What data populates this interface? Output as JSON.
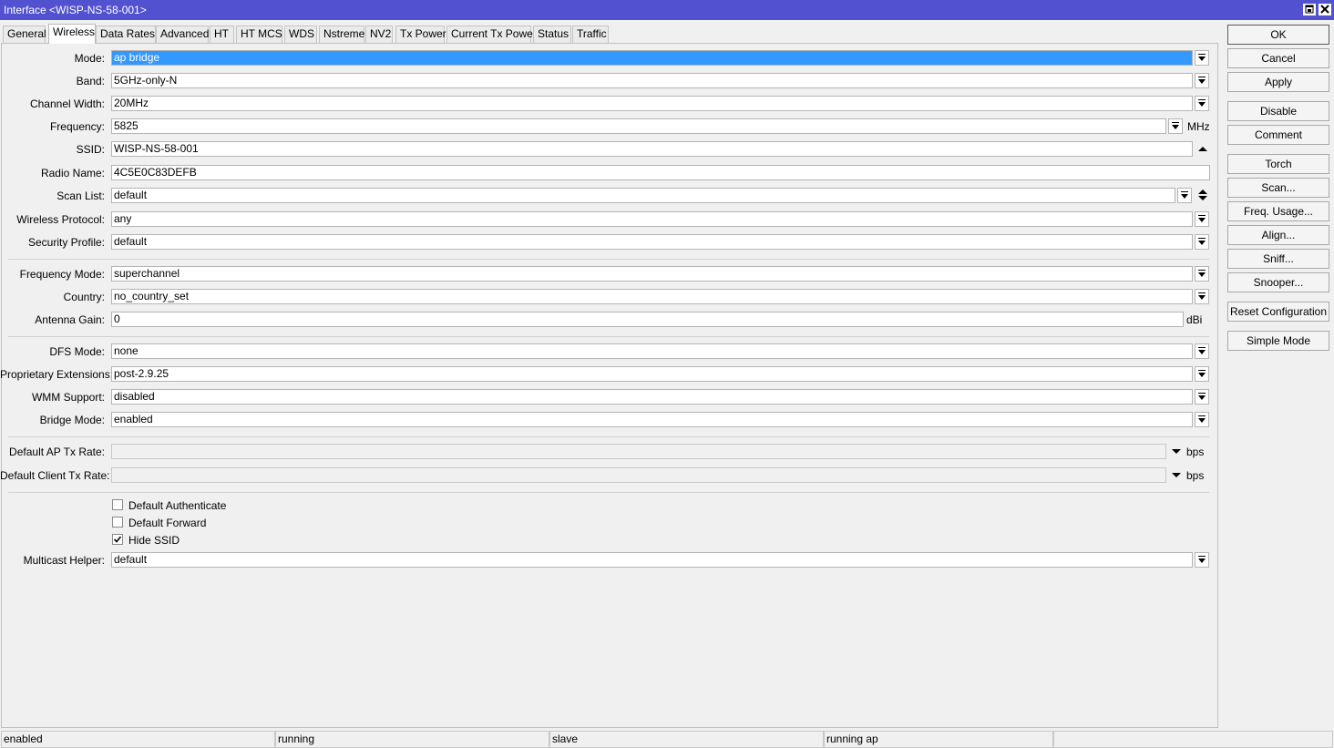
{
  "window": {
    "title": "Interface <WISP-NS-58-001>",
    "restore_symbol": "▫",
    "close_symbol": "✕"
  },
  "tabs": [
    {
      "label": "General"
    },
    {
      "label": "Wireless",
      "active": true
    },
    {
      "label": "Data Rates"
    },
    {
      "label": "Advanced"
    },
    {
      "label": "HT"
    },
    {
      "label": "HT MCS"
    },
    {
      "label": "WDS"
    },
    {
      "label": "Nstreme"
    },
    {
      "label": "NV2"
    },
    {
      "label": "Tx Power"
    },
    {
      "label": "Current Tx Power"
    },
    {
      "label": "Status"
    },
    {
      "label": "Traffic"
    }
  ],
  "form": {
    "mode": {
      "label": "Mode:",
      "value": "ap bridge"
    },
    "band": {
      "label": "Band:",
      "value": "5GHz-only-N"
    },
    "channel_width": {
      "label": "Channel Width:",
      "value": "20MHz"
    },
    "frequency": {
      "label": "Frequency:",
      "value": "5825",
      "unit": "MHz"
    },
    "ssid": {
      "label": "SSID:",
      "value": "WISP-NS-58-001"
    },
    "radio_name": {
      "label": "Radio Name:",
      "value": "4C5E0C83DEFB"
    },
    "scan_list": {
      "label": "Scan List:",
      "value": "default"
    },
    "wireless_protocol": {
      "label": "Wireless Protocol:",
      "value": "any"
    },
    "security_profile": {
      "label": "Security Profile:",
      "value": "default"
    },
    "frequency_mode": {
      "label": "Frequency Mode:",
      "value": "superchannel"
    },
    "country": {
      "label": "Country:",
      "value": "no_country_set"
    },
    "antenna_gain": {
      "label": "Antenna Gain:",
      "value": "0",
      "unit": "dBi"
    },
    "dfs_mode": {
      "label": "DFS Mode:",
      "value": "none"
    },
    "proprietary_extensions": {
      "label": "Proprietary Extensions:",
      "value": "post-2.9.25"
    },
    "wmm_support": {
      "label": "WMM Support:",
      "value": "disabled"
    },
    "bridge_mode": {
      "label": "Bridge Mode:",
      "value": "enabled"
    },
    "default_ap_tx_rate": {
      "label": "Default AP Tx Rate:",
      "value": "",
      "unit": "bps"
    },
    "default_client_tx_rate": {
      "label": "Default Client Tx Rate:",
      "value": "",
      "unit": "bps"
    },
    "default_authenticate": {
      "label": "Default Authenticate",
      "checked": false
    },
    "default_forward": {
      "label": "Default Forward",
      "checked": false
    },
    "hide_ssid": {
      "label": "Hide SSID",
      "checked": true
    },
    "multicast_helper": {
      "label": "Multicast Helper:",
      "value": "default"
    }
  },
  "buttons": {
    "ok": "OK",
    "cancel": "Cancel",
    "apply": "Apply",
    "disable": "Disable",
    "comment": "Comment",
    "torch": "Torch",
    "scan": "Scan...",
    "freq_usage": "Freq. Usage...",
    "align": "Align...",
    "sniff": "Sniff...",
    "snooper": "Snooper...",
    "reset_configuration": "Reset Configuration",
    "simple_mode": "Simple Mode"
  },
  "statusbar": [
    "enabled",
    "running",
    "slave",
    "running ap",
    ""
  ]
}
